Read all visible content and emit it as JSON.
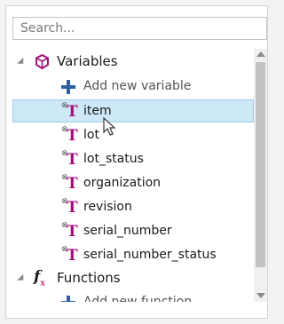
{
  "search": {
    "placeholder": "Search..."
  },
  "tree": {
    "variables_label": "Variables",
    "add_variable_label": "Add new variable",
    "variables": [
      {
        "label": "item",
        "selected": true
      },
      {
        "label": "lot"
      },
      {
        "label": "lot_status"
      },
      {
        "label": "organization"
      },
      {
        "label": "revision"
      },
      {
        "label": "serial_number"
      },
      {
        "label": "serial_number_status"
      }
    ],
    "functions_label": "Functions",
    "add_function_label": "Add new function"
  },
  "colors": {
    "selection": "#cde8f6",
    "type_icon": "#a4127a",
    "add_icon": "#2f5f9e"
  },
  "icons": {
    "variables": "cube-icon",
    "functions": "fx-icon",
    "variable_type": "text-type-icon",
    "add": "plus-icon"
  }
}
